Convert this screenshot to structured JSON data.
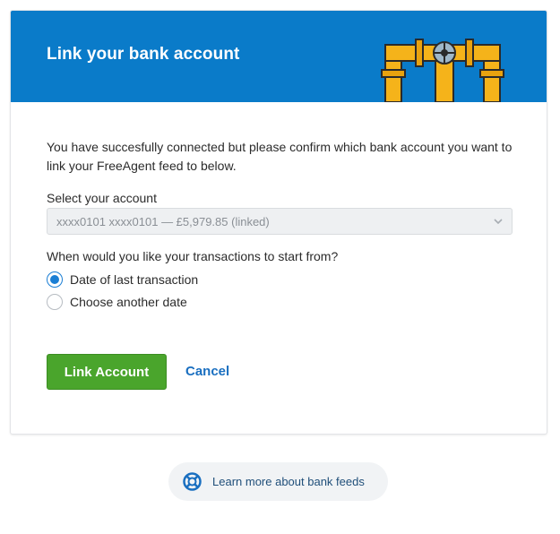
{
  "header": {
    "title": "Link your bank account",
    "decoration_icon": "pipes-valve-illustration",
    "background_color": "#0a7bc9"
  },
  "intro": {
    "text": "You have succesfully connected but please confirm which bank account you want to link your FreeAgent feed to below."
  },
  "account_select": {
    "label": "Select your account",
    "value": "xxxx0101 xxxx0101 — £5,979.85 (linked)",
    "icon": "chevron-down-icon"
  },
  "start_from": {
    "question": "When would you like your transactions to start from?",
    "options": [
      {
        "label": "Date of last transaction",
        "checked": true
      },
      {
        "label": "Choose another date",
        "checked": false
      }
    ]
  },
  "actions": {
    "primary_label": "Link Account",
    "primary_color": "#4aa52c",
    "cancel_label": "Cancel",
    "link_color": "#1a6fc0"
  },
  "help": {
    "icon": "lifebuoy-icon",
    "label": "Learn more about bank feeds"
  }
}
